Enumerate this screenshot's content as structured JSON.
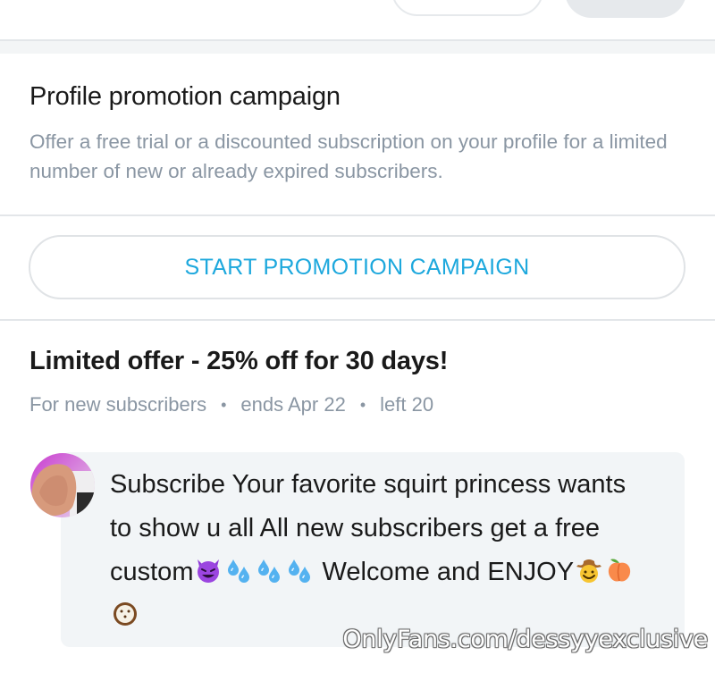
{
  "promotion": {
    "title": "Profile promotion campaign",
    "description": "Offer a free trial or a discounted subscription on your profile for a limited number of new or already expired subscribers.",
    "start_button_label": "START PROMOTION CAMPAIGN"
  },
  "offer": {
    "title": "Limited offer - 25% off for 30 days!",
    "audience": "For new subscribers",
    "ends": "ends Apr 22",
    "left": "left 20",
    "separator": "•"
  },
  "message": {
    "text_part_1": "Subscribe Your favorite squirt princess wants to show u all All new subscribers get a free custom",
    "text_part_2": " Welcome and ENJOY",
    "emojis": [
      "smiling-devil-icon",
      "sweat-droplets-icon",
      "sweat-droplets-icon",
      "sweat-droplets-icon",
      "cowboy-face-icon",
      "peach-icon",
      "coconut-icon"
    ]
  },
  "watermark": {
    "text": "OnlyFans.com/dessyyexclusive"
  },
  "colors": {
    "accent": "#1da8dd",
    "muted_text": "#8a96a3",
    "divider": "#e3e6e9",
    "bubble_bg": "#f2f5f7"
  }
}
